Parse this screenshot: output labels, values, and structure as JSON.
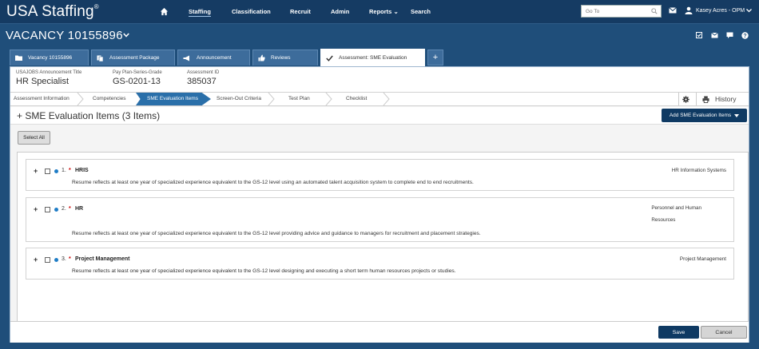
{
  "app": {
    "brand": "USA Staffing",
    "brand_mark": "®"
  },
  "nav": {
    "items": [
      {
        "label": "Staffing"
      },
      {
        "label": "Classification"
      },
      {
        "label": "Recruit"
      },
      {
        "label": "Admin"
      },
      {
        "label": "Reports"
      },
      {
        "label": "Search"
      }
    ],
    "reports_caret": "⌄",
    "goto_placeholder": "Go To",
    "user_name": "Kasey Acres - OPM"
  },
  "vacancy": {
    "title": "VACANCY 10155896"
  },
  "tabs": [
    {
      "label": "Vacancy 10155896",
      "icon": "folder-icon"
    },
    {
      "label": "Assessment Package",
      "icon": "copy-icon"
    },
    {
      "label": "Announcement",
      "icon": "megaphone-icon"
    },
    {
      "label": "Reviews",
      "icon": "thumbs-up-icon"
    },
    {
      "label": "Assessment: SME Evaluation",
      "icon": "check-icon"
    }
  ],
  "tab_add_label": "+",
  "info": {
    "announcement_title_label": "USAJOBS Announcement Title",
    "announcement_title_value": "HR Specialist",
    "pay_plan_label": "Pay Plan-Series-Grade",
    "pay_plan_value": "GS-0201-13",
    "assessment_id_label": "Assessment ID",
    "assessment_id_value": "385037"
  },
  "steps": [
    {
      "label": "Assessment Information"
    },
    {
      "label": "Competencies"
    },
    {
      "label": "SME Evaluation Items"
    },
    {
      "label": "Screen-Out Criteria"
    },
    {
      "label": "Test Plan"
    },
    {
      "label": "Checklist"
    }
  ],
  "history_label": "History",
  "section": {
    "title": "SME Evaluation Items (3 Items)",
    "expand": "+",
    "add_button": "Add SME Evaluation Items"
  },
  "select_all_label": "Select All",
  "items": [
    {
      "number": "1.",
      "required": "*",
      "name": "HRIS",
      "description": "Resume reflects at least one year of specialized experience equivalent to the GS-12 level using an automated talent acquisition system to complete end to end recruitments.",
      "category_line1": "HR Information Systems",
      "category_line2": ""
    },
    {
      "number": "2.",
      "required": "*",
      "name": "HR",
      "description": "Resume reflects at least one year of specialized experience equivalent to the GS-12 level providing advice and guidance to managers for recruitment and placement strategies.",
      "category_line1": "Personnel and Human",
      "category_line2": "Resources"
    },
    {
      "number": "3.",
      "required": "*",
      "name": "Project Management",
      "description": "Resume reflects at least one year of specialized experience equivalent to the GS-12 level designing and executing a short term human resources projects or studies.",
      "category_line1": "Project Management",
      "category_line2": ""
    }
  ],
  "footer": {
    "save_label": "Save",
    "cancel_label": "Cancel"
  },
  "colors": {
    "header_bg": "#153b63",
    "page_bg": "#1f4e7a",
    "primary_button": "#0f3a63",
    "active_step": "#2a6fa9",
    "status_dot": "#1f7dc6",
    "required_mark": "#cc0000"
  }
}
